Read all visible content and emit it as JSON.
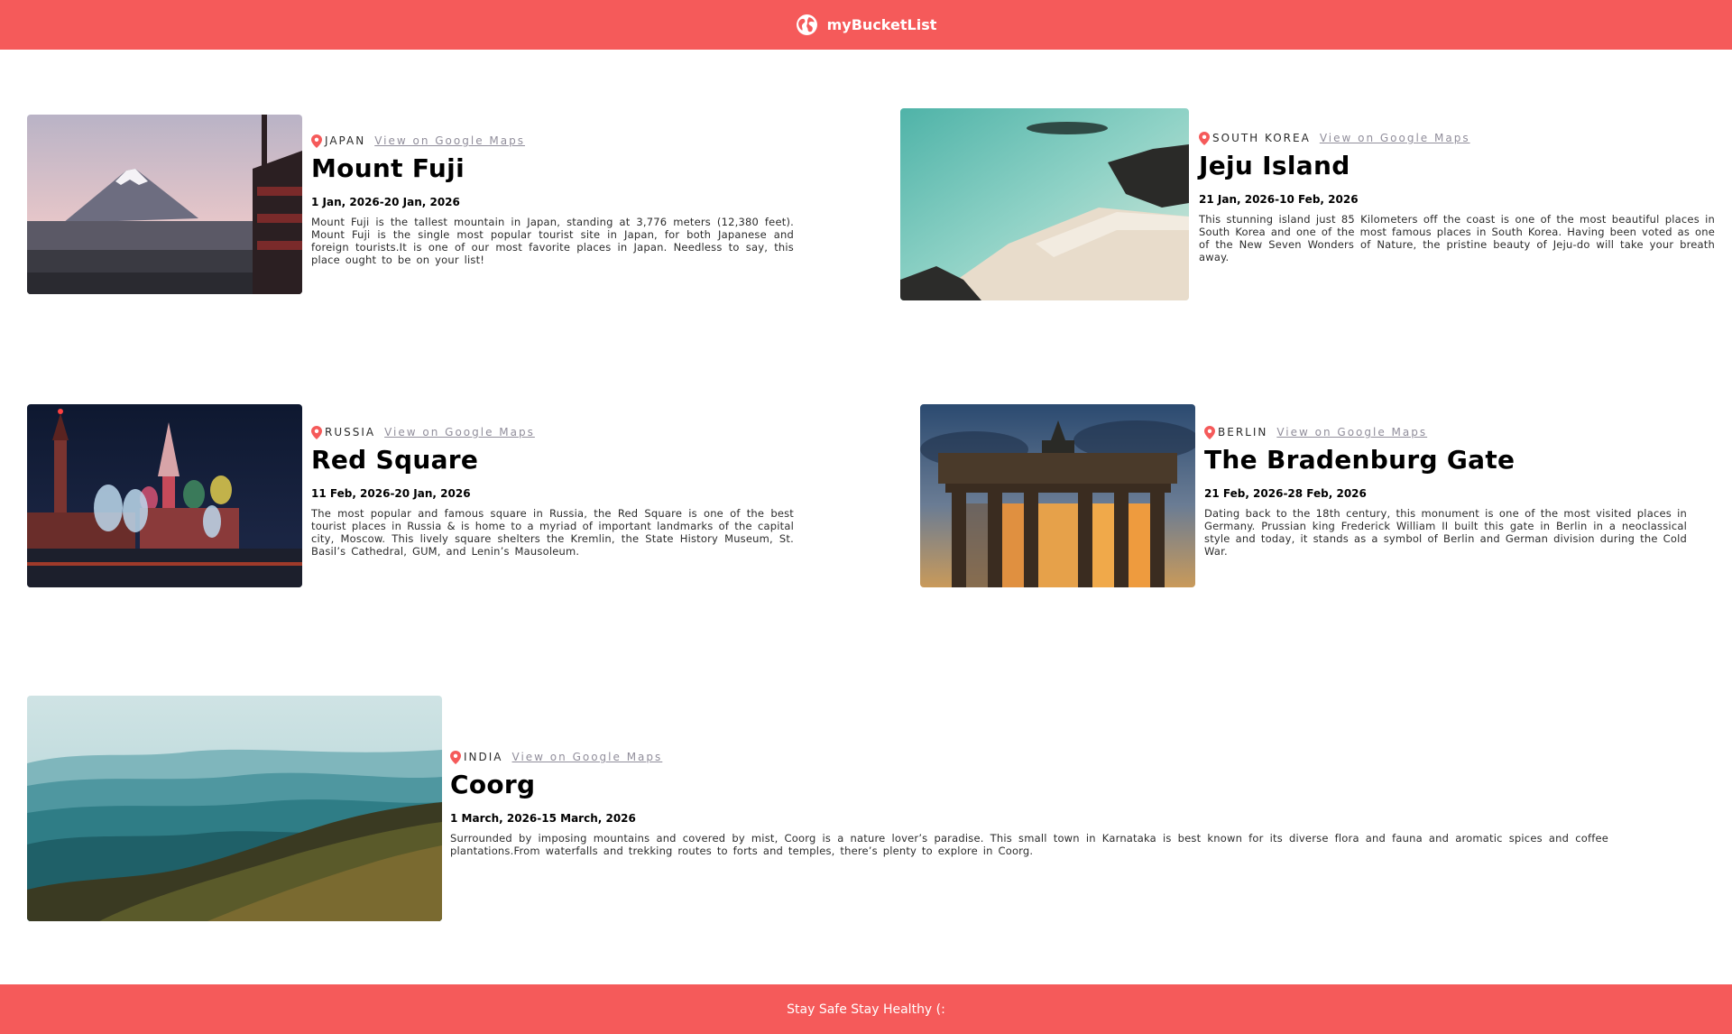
{
  "header": {
    "brand": "myBucketList"
  },
  "destinations": [
    {
      "country": "JAPAN",
      "maps_link": "View on Google Maps",
      "title": "Mount Fuji",
      "dates": "1 Jan, 2026-20 Jan, 2026",
      "description": "Mount Fuji is the tallest mountain in Japan, standing at 3,776 meters (12,380 feet). Mount Fuji is the single most popular tourist site in Japan, for both Japanese and foreign tourists.It is one of our most favorite places in Japan. Needless to say, this place ought to be on your list!"
    },
    {
      "country": "SOUTH KOREA",
      "maps_link": "View on Google Maps",
      "title": "Jeju Island",
      "dates": "21 Jan, 2026-10 Feb, 2026",
      "description": "This stunning island just 85 Kilometers off the coast is one of the most beautiful places in South Korea and one of the most famous places in South Korea. Having been voted as one of the New Seven Wonders of Nature, the pristine beauty of Jeju-do will take your breath away."
    },
    {
      "country": "RUSSIA",
      "maps_link": "View on Google Maps",
      "title": "Red Square",
      "dates": "11 Feb, 2026-20 Jan, 2026",
      "description": "The most popular and famous square in Russia, the Red Square is one of the best tourist places in Russia & is home to a myriad of important landmarks of the capital city, Moscow. This lively square shelters the Kremlin, the State History Museum, St. Basil’s Cathedral, GUM, and Lenin’s Mausoleum."
    },
    {
      "country": "BERLIN",
      "maps_link": "View on Google Maps",
      "title": "The Bradenburg Gate",
      "dates": "21 Feb, 2026-28 Feb, 2026",
      "description": "Dating back to the 18th century, this monument is one of the most visited places in Germany. Prussian king Frederick William II built this gate in Berlin in a neoclassical style and today, it stands as a symbol of Berlin and German division during the Cold War."
    },
    {
      "country": "INDIA",
      "maps_link": "View on Google Maps",
      "title": "Coorg",
      "dates": "1 March, 2026-15 March, 2026",
      "description": "Surrounded by imposing mountains and covered by mist, Coorg is a nature lover’s paradise. This small town in Karnataka is best known for its diverse flora and fauna and aromatic spices and coffee plantations.From waterfalls and trekking routes to forts and temples, there’s plenty to explore in Coorg."
    }
  ],
  "footer": {
    "text": "Stay Safe Stay Healthy (:"
  },
  "colors": {
    "accent": "#f55a5a",
    "link": "#918e9b"
  }
}
